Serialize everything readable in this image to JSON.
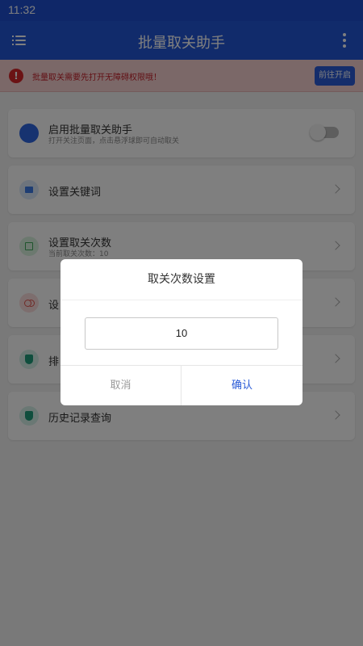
{
  "status_bar": {
    "time": "11:32"
  },
  "app_bar": {
    "title": "批量取关助手"
  },
  "warning": {
    "text": "批量取关需要先打开无障碍权限哦！",
    "button_label": "前往开启",
    "color": "#d6262b"
  },
  "cards": [
    {
      "title": "启用批量取关助手",
      "subtitle": "打开关注页面，点击悬浮球即可自动取关",
      "icon": "blue-dot-icon"
    },
    {
      "title": "设置关键词",
      "icon": "keyword-icon"
    },
    {
      "title": "设置取关次数",
      "subtitle": "当前取关次数：10",
      "icon": "count-icon"
    },
    {
      "title": "设",
      "icon": "link-icon"
    },
    {
      "title": "排",
      "icon": "shield-icon"
    },
    {
      "title": "历史记录查询",
      "icon": "shield-icon"
    }
  ],
  "dialog": {
    "title": "取关次数设置",
    "input_value": "10",
    "cancel_label": "取消",
    "confirm_label": "确认"
  },
  "colors": {
    "primary": "#2356d6",
    "status_bar": "#1f4fd0",
    "warning_bg": "#f6d1d1"
  }
}
